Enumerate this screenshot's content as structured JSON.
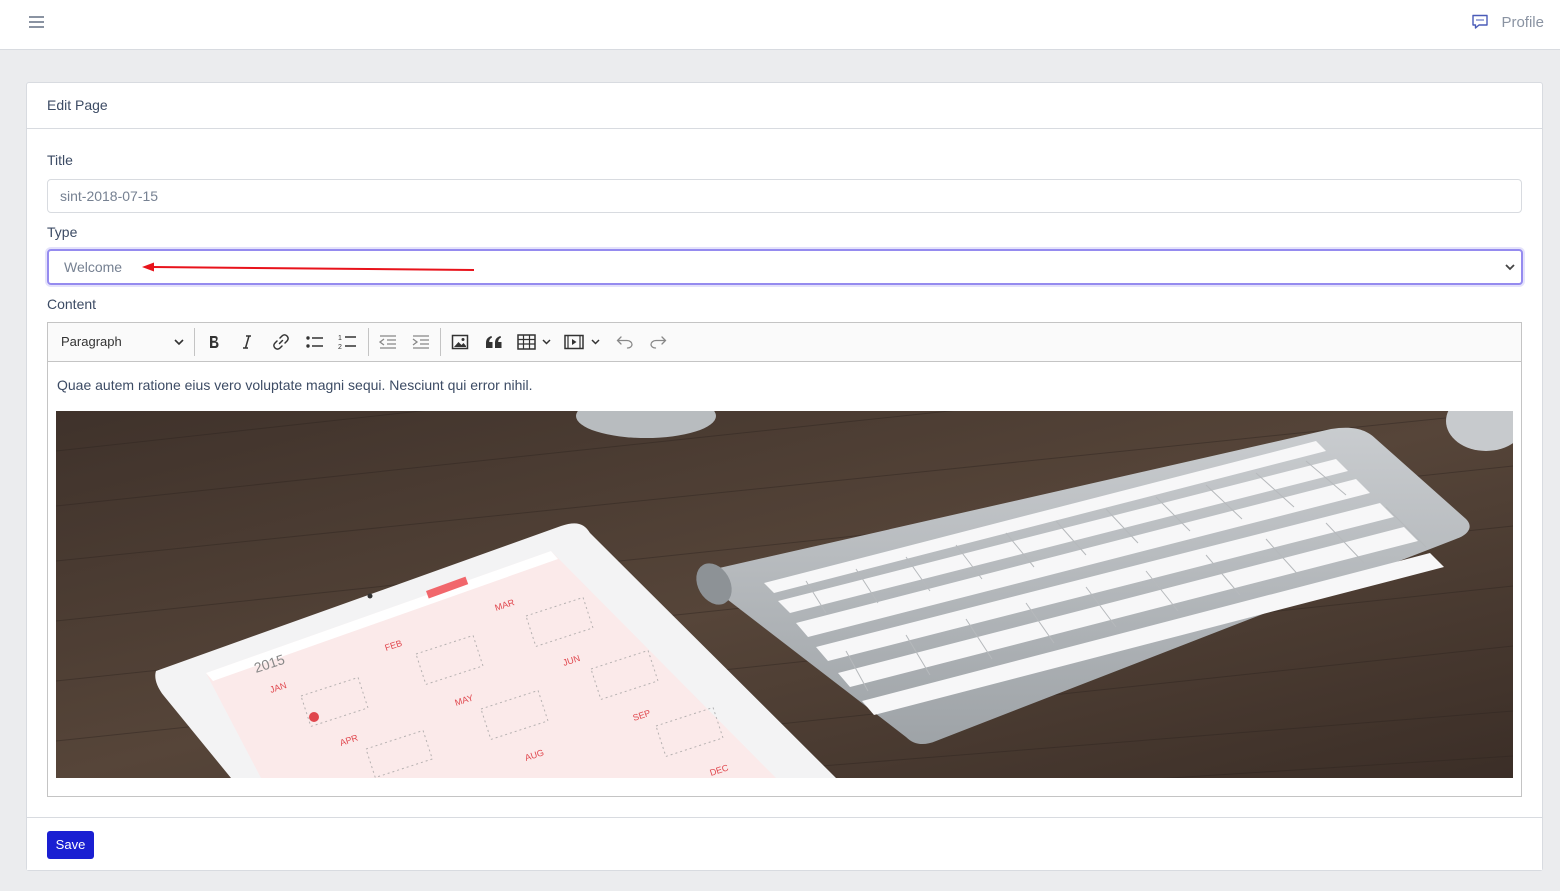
{
  "topbar": {
    "menu_icon": "hamburger-icon",
    "chat_icon": "speech-bubble-icon",
    "profile_label": "Profile"
  },
  "card": {
    "header_title": "Edit Page",
    "title_label": "Title",
    "title_value": "sint-2018-07-15",
    "type_label": "Type",
    "type_value": "Welcome",
    "content_label": "Content",
    "save_label": "Save"
  },
  "editor": {
    "heading_dropdown": "Paragraph",
    "toolbar_icons": [
      "bold-icon",
      "italic-icon",
      "link-icon",
      "bulleted-list-icon",
      "numbered-list-icon",
      "outdent-icon",
      "indent-icon",
      "image-icon",
      "blockquote-icon",
      "table-icon",
      "media-icon",
      "undo-icon",
      "redo-icon"
    ],
    "paragraph": "Quae autem ratione eius vero voluptate magni sequi. Nesciunt qui error nihil."
  },
  "colors": {
    "accent": "#1a1fd2",
    "focus_border": "#958bef",
    "annotation_arrow": "#e8131b"
  }
}
